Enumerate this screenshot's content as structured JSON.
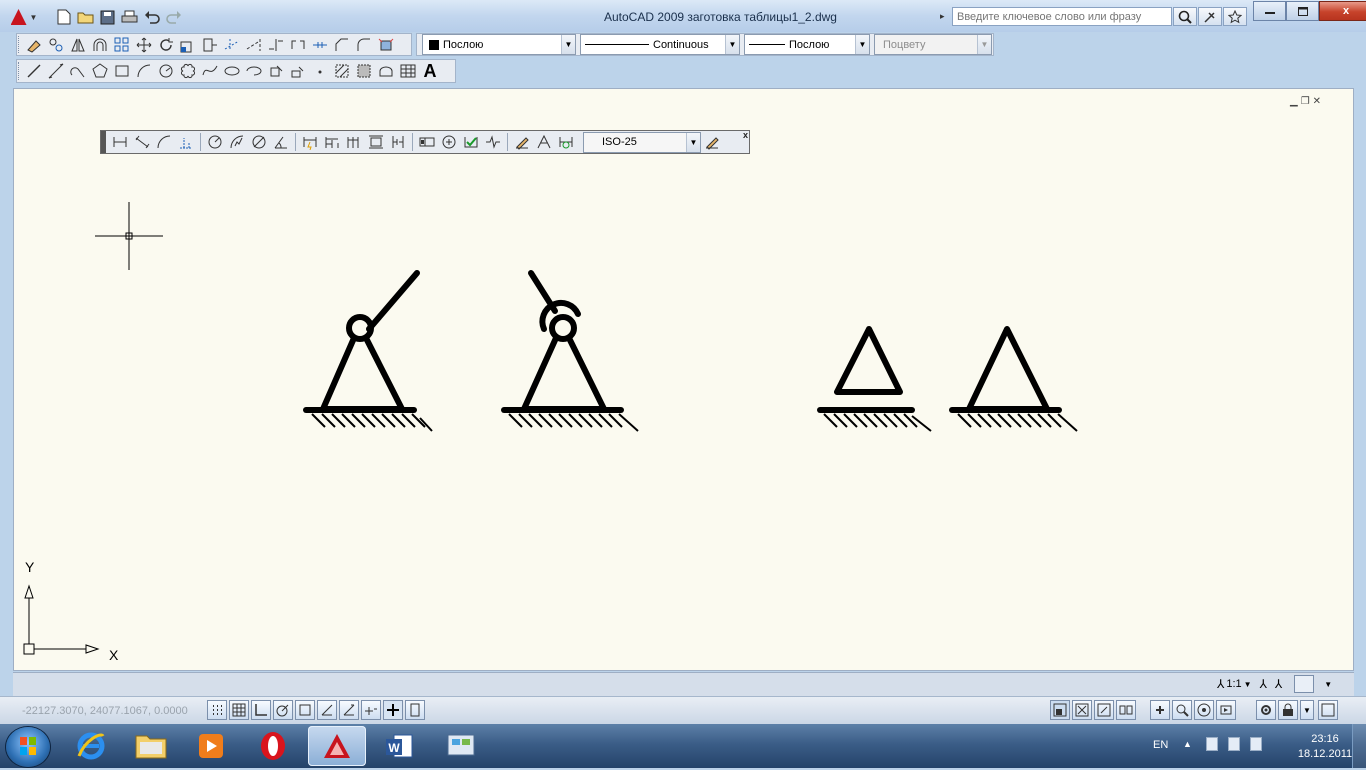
{
  "window": {
    "title": "AutoCAD 2009 заготовка таблицы1_2.dwg",
    "search_placeholder": "Введите ключевое слово или фразу",
    "minimize_icon": "minimize-icon",
    "maximize_icon": "maximize-icon",
    "close_label": "x"
  },
  "properties_toolbar": {
    "color_value": "Послою",
    "linetype_value": "Continuous",
    "lineweight_value": "Послою",
    "plotstyle_value": "Поцвету"
  },
  "dimension_toolbar": {
    "dim_style_value": "ISO-25"
  },
  "drawing": {
    "ucs_x_label": "X",
    "ucs_y_label": "Y"
  },
  "status": {
    "coordinates": "-22127.3070, 24077.1067, 0.0000",
    "annotation_scale": "1:1"
  },
  "taskbar": {
    "language": "EN",
    "time": "23:16",
    "date": "18.12.2011"
  },
  "colors": {
    "drawing_background": "#fbfaf0",
    "title_bar": "#c2d6ee",
    "taskbar": "#3b5d87",
    "close_button": "#c7432b"
  }
}
